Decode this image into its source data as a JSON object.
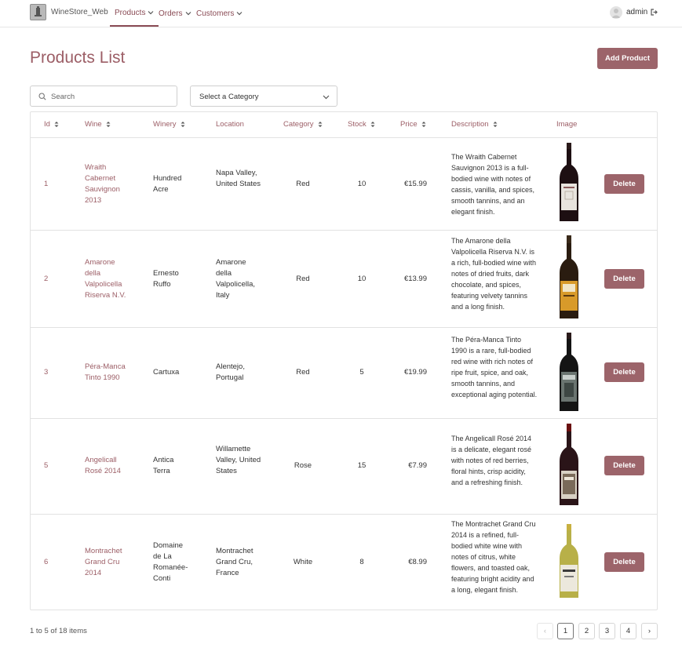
{
  "nav": {
    "brand": "WineStore_Web",
    "items": [
      {
        "label": "Products"
      },
      {
        "label": "Orders"
      },
      {
        "label": "Customers"
      }
    ],
    "username": "admin"
  },
  "page": {
    "title": "Products List",
    "add_button": "Add Product"
  },
  "filters": {
    "search_placeholder": "Search",
    "category_select": "Select a Category"
  },
  "table": {
    "columns": [
      "Id",
      "Wine",
      "Winery",
      "Location",
      "Category",
      "Stock",
      "Price",
      "Description",
      "Image"
    ],
    "delete_label": "Delete",
    "rows": [
      {
        "id": "1",
        "wine": "Wraith Cabernet Sauvignon 2013",
        "winery": "Hundred Acre",
        "location": "Napa Valley, United States",
        "category": "Red",
        "stock": "10",
        "price": "€15.99",
        "description": "The Wraith Cabernet Sauvignon 2013 is a full-bodied wine with notes of cassis, vanilla, and spices, smooth tannins, and an elegant finish."
      },
      {
        "id": "2",
        "wine": "Amarone della Valpolicella Riserva N.V.",
        "winery": "Ernesto Ruffo",
        "location": "Amarone della Valpolicella, Italy",
        "category": "Red",
        "stock": "10",
        "price": "€13.99",
        "description": "The Amarone della Valpolicella Riserva N.V. is a rich, full-bodied wine with notes of dried fruits, dark chocolate, and spices, featuring velvety tannins and a long finish."
      },
      {
        "id": "3",
        "wine": "Péra-Manca Tinto 1990",
        "winery": "Cartuxa",
        "location": "Alentejo, Portugal",
        "category": "Red",
        "stock": "5",
        "price": "€19.99",
        "description": "The Péra-Manca Tinto 1990 is a rare, full-bodied red wine with rich notes of ripe fruit, spice, and oak, smooth tannins, and exceptional aging potential."
      },
      {
        "id": "5",
        "wine": "Angelicall Rosé 2014",
        "winery": "Antica Terra",
        "location": "Willamette Valley, United States",
        "category": "Rose",
        "stock": "15",
        "price": "€7.99",
        "description": "The Angelicall Rosé 2014 is a delicate, elegant rosé with notes of red berries, floral hints, crisp acidity, and a refreshing finish."
      },
      {
        "id": "6",
        "wine": "Montrachet Grand Cru 2014",
        "winery": "Domaine de La Romanée-Conti",
        "location": "Montrachet Grand Cru, France",
        "category": "White",
        "stock": "8",
        "price": "€8.99",
        "description": "The Montrachet Grand Cru 2014 is a refined, full-bodied white wine with notes of citrus, white flowers, and toasted oak, featuring bright acidity and a long, elegant finish."
      }
    ]
  },
  "pagination": {
    "info": "1 to 5 of 18 items",
    "pages": [
      "1",
      "2",
      "3",
      "4"
    ],
    "current": "1",
    "prev": "‹",
    "next": "›"
  },
  "colors": {
    "accent": "#9c646a",
    "link": "#9c5e66"
  }
}
